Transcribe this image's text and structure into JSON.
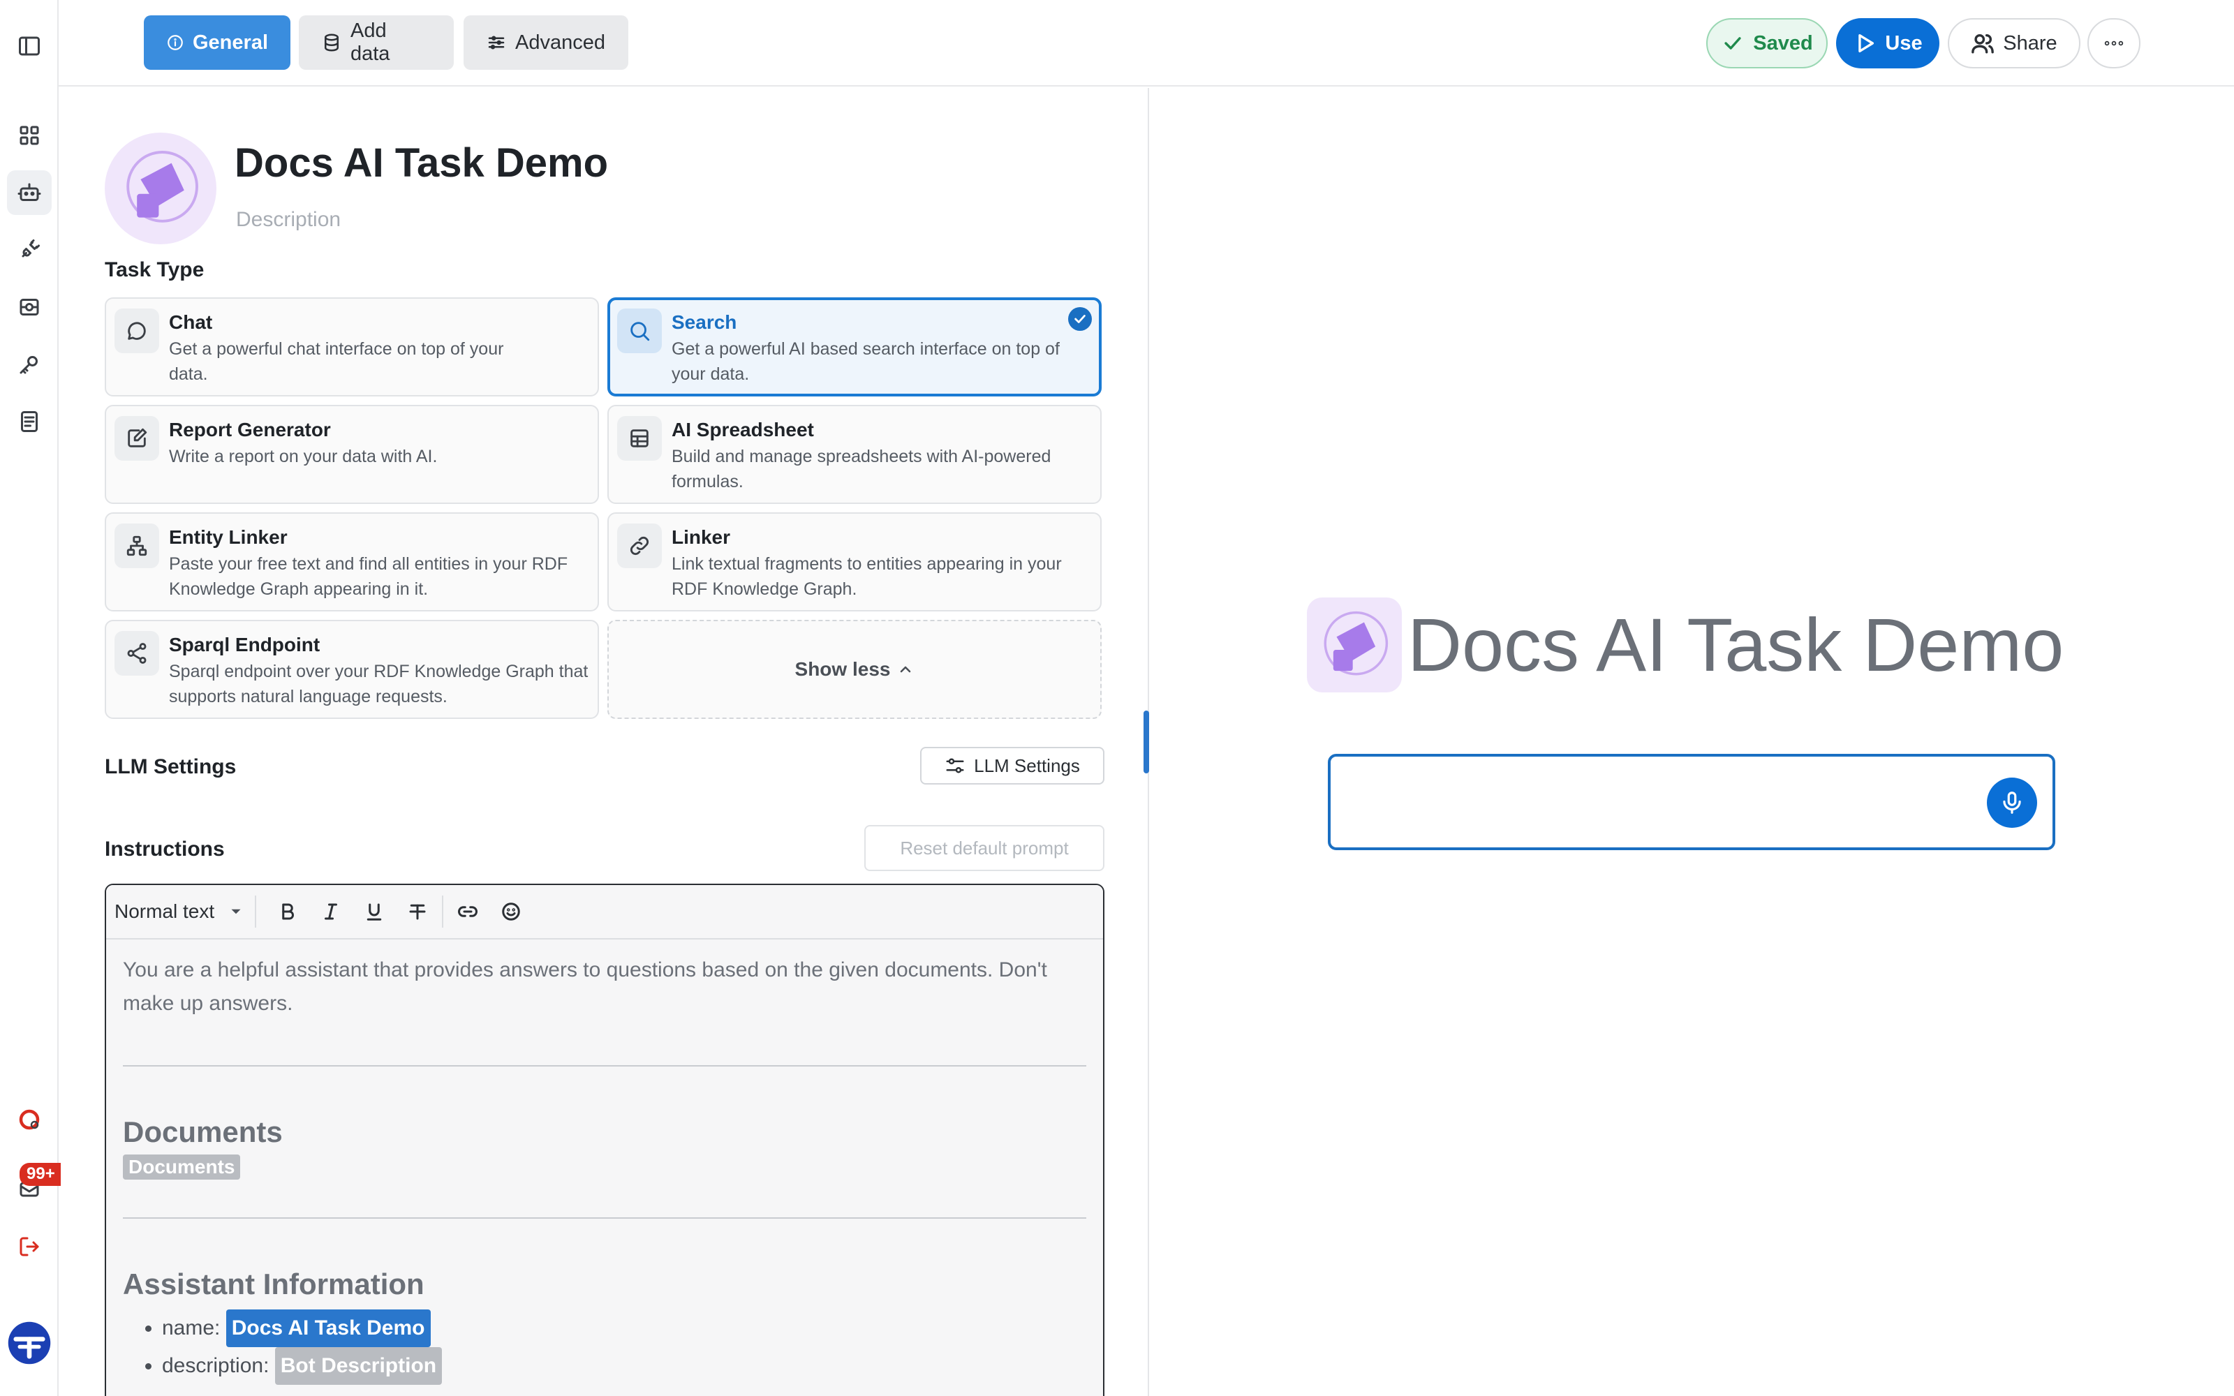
{
  "topbar": {
    "tabs": [
      {
        "label": "General",
        "icon": "info-icon",
        "active": true
      },
      {
        "label": "Add data",
        "icon": "database-icon",
        "active": false
      },
      {
        "label": "Advanced",
        "icon": "sliders-icon",
        "active": false
      }
    ],
    "saved_label": "Saved",
    "use_label": "Use",
    "share_label": "Share"
  },
  "bot": {
    "name": "Docs AI Task Demo",
    "description_placeholder": "Description"
  },
  "task_type": {
    "label": "Task Type",
    "options": [
      {
        "title": "Chat",
        "description": "Get a powerful chat interface on top of your data.",
        "icon": "chat-bubble-icon",
        "selected": false
      },
      {
        "title": "Search",
        "description": "Get a powerful AI based search interface on top of your data.",
        "icon": "search-icon",
        "selected": true
      },
      {
        "title": "Report Generator",
        "description": "Write a report on your data with AI.",
        "icon": "report-edit-icon",
        "selected": false
      },
      {
        "title": "AI Spreadsheet",
        "description": "Build and manage spreadsheets with AI-powered formulas.",
        "icon": "table-icon",
        "selected": false
      },
      {
        "title": "Entity Linker",
        "description": "Paste your free text and find all entities in your RDF Knowledge Graph appearing in it.",
        "icon": "hierarchy-icon",
        "selected": false
      },
      {
        "title": "Linker",
        "description": "Link textual fragments to entities appearing in your RDF Knowledge Graph.",
        "icon": "link-icon",
        "selected": false
      },
      {
        "title": "Sparql Endpoint",
        "description": "Sparql endpoint over your RDF Knowledge Graph that supports natural language requests.",
        "icon": "share-nodes-icon",
        "selected": false
      }
    ],
    "show_less_label": "Show less"
  },
  "llm_settings": {
    "section_label": "LLM Settings",
    "button_label": "LLM Settings"
  },
  "instructions": {
    "section_label": "Instructions",
    "reset_label": "Reset default prompt",
    "text_style": "Normal text",
    "prompt": "You are a helpful assistant that provides answers to questions based on the given documents. Don't make up answers.",
    "documents_heading": "Documents",
    "documents_chip": "Documents",
    "assistant_heading": "Assistant Information",
    "name_key": "name:",
    "name_value": "Docs AI Task Demo",
    "description_key": "description:",
    "description_value": "Bot Description"
  },
  "rail": {
    "badge": "99+"
  },
  "preview": {
    "title": "Docs AI Task Demo"
  },
  "colors": {
    "primary": "#0a6fd6",
    "tab_active": "#3a8dde",
    "selected_border": "#1a7bd4",
    "saved_green": "#1f8a4c",
    "avatar_purple": "#a77bea"
  }
}
